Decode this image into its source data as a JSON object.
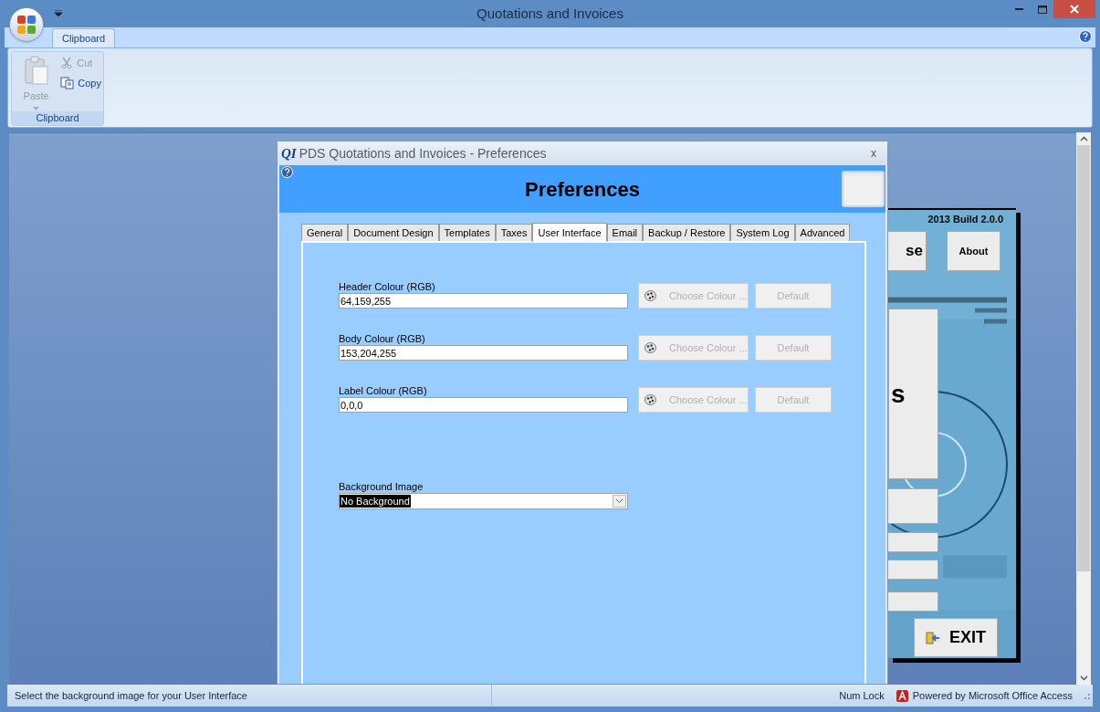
{
  "window": {
    "title": "Quotations and Invoices"
  },
  "ribbon": {
    "tabs": [
      {
        "label": "Clipboard",
        "selected": true
      }
    ],
    "groups": [
      {
        "title": "Clipboard",
        "commands": [
          {
            "label": "Paste",
            "kind": "large",
            "disabled": true
          },
          {
            "label": "Cut",
            "kind": "small",
            "disabled": true
          },
          {
            "label": "Copy",
            "kind": "small",
            "disabled": false
          }
        ]
      }
    ]
  },
  "main_form": {
    "build": "2013 Build 2.0.0",
    "buttons": [
      "se",
      "About"
    ],
    "panel_text": "s",
    "exit_button": "EXIT"
  },
  "dialog": {
    "badge": "QI",
    "title": "PDS Quotations and Invoices - Preferences",
    "close": "x",
    "heading": "Preferences",
    "tabs": [
      {
        "label": "General",
        "selected": false
      },
      {
        "label": "Document Design",
        "selected": false
      },
      {
        "label": "Templates",
        "selected": false
      },
      {
        "label": "Taxes",
        "selected": false
      },
      {
        "label": "User Interface",
        "selected": true
      },
      {
        "label": "Email",
        "selected": false
      },
      {
        "label": "Backup / Restore",
        "selected": false
      },
      {
        "label": "System Log",
        "selected": false
      },
      {
        "label": "Advanced",
        "selected": false
      }
    ],
    "colour_fields": [
      {
        "label": "Header Colour (RGB)",
        "value": "64,159,255",
        "choose_button": "Choose Colour ...",
        "default_button": "Default",
        "disabled": true
      },
      {
        "label": "Body Colour (RGB)",
        "value": "153,204,255",
        "choose_button": "Choose Colour ...",
        "default_button": "Default",
        "disabled": true
      },
      {
        "label": "Label Colour (RGB)",
        "value": "0,0,0",
        "choose_button": "Choose Colour ...",
        "default_button": "Default",
        "disabled": true
      }
    ],
    "background": {
      "label": "Background Image",
      "value": "No Background"
    }
  },
  "status_bar": {
    "message": "Select the background image for your User Interface",
    "num_lock": "Num Lock",
    "powered_by": "Powered by Microsoft Office Access"
  }
}
